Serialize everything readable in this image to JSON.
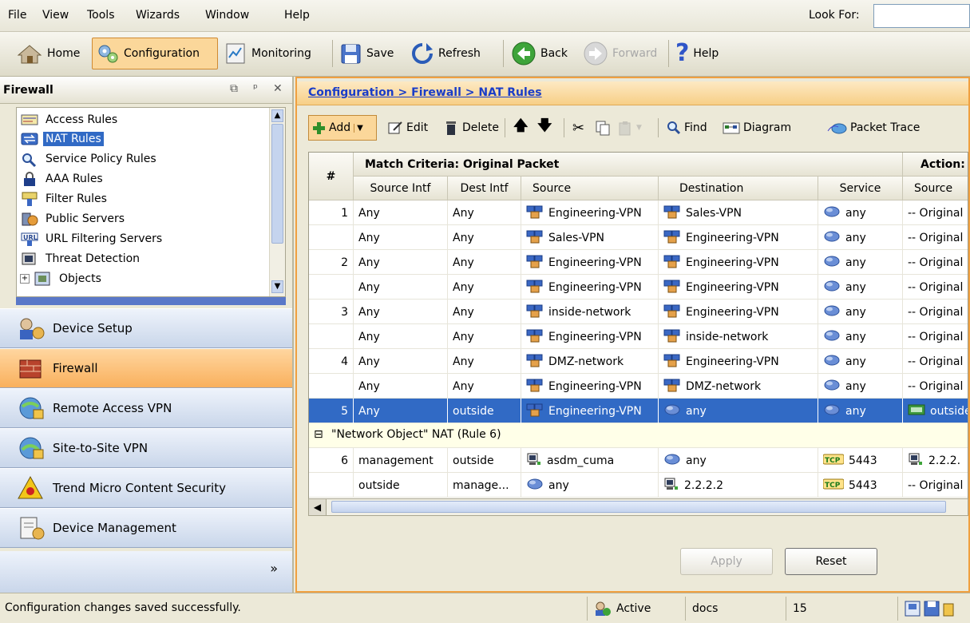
{
  "menubar": {
    "items": [
      "File",
      "View",
      "Tools",
      "Wizards",
      "Window",
      "Help"
    ],
    "look_for_label": "Look For:",
    "look_for_value": ""
  },
  "toolbar": {
    "home": "Home",
    "configuration": "Configuration",
    "monitoring": "Monitoring",
    "save": "Save",
    "refresh": "Refresh",
    "back": "Back",
    "forward": "Forward",
    "help": "Help"
  },
  "left_panel": {
    "title": "Firewall",
    "tree": [
      {
        "label": "Access Rules",
        "icon": "access-rules-icon"
      },
      {
        "label": "NAT Rules",
        "icon": "nat-rules-icon",
        "selected": true
      },
      {
        "label": "Service Policy Rules",
        "icon": "magnifier-icon"
      },
      {
        "label": "AAA Rules",
        "icon": "lock-icon"
      },
      {
        "label": "Filter Rules",
        "icon": "filter-icon"
      },
      {
        "label": "Public Servers",
        "icon": "public-servers-icon"
      },
      {
        "label": "URL Filtering Servers",
        "icon": "url-icon"
      },
      {
        "label": "Threat Detection",
        "icon": "threat-icon"
      },
      {
        "label": "Objects",
        "icon": "objects-icon"
      }
    ],
    "nav": [
      {
        "label": "Device Setup",
        "icon": "device-setup-icon"
      },
      {
        "label": "Firewall",
        "icon": "firewall-icon",
        "active": true
      },
      {
        "label": "Remote Access VPN",
        "icon": "remote-vpn-icon"
      },
      {
        "label": "Site-to-Site VPN",
        "icon": "site-vpn-icon"
      },
      {
        "label": "Trend Micro Content Security",
        "icon": "biohazard-icon"
      },
      {
        "label": "Device Management",
        "icon": "device-management-icon"
      }
    ],
    "more": "»"
  },
  "main": {
    "breadcrumb": "Configuration > Firewall > NAT Rules",
    "rule_toolbar": {
      "add": "Add",
      "edit": "Edit",
      "delete": "Delete",
      "find": "Find",
      "diagram": "Diagram",
      "packet_trace": "Packet Trace"
    },
    "table": {
      "header_num": "#",
      "group_match": "Match Criteria: Original Packet",
      "group_action": "Action:",
      "columns": [
        "Source Intf",
        "Dest Intf",
        "Source",
        "Destination",
        "Service",
        "Source"
      ],
      "rows": [
        {
          "num": "1",
          "src_intf": "Any",
          "dst_intf": "Any",
          "source": "Engineering-VPN",
          "source_icon": "network-group-icon",
          "destination": "Sales-VPN",
          "destination_icon": "network-group-icon",
          "service": "any",
          "service_icon": "service-any-icon",
          "action_source": "-- Original"
        },
        {
          "num": "",
          "src_intf": "Any",
          "dst_intf": "Any",
          "source": "Sales-VPN",
          "source_icon": "network-group-icon",
          "destination": "Engineering-VPN",
          "destination_icon": "network-group-icon",
          "service": "any",
          "service_icon": "service-any-icon",
          "action_source": "-- Original"
        },
        {
          "num": "2",
          "src_intf": "Any",
          "dst_intf": "Any",
          "source": "Engineering-VPN",
          "source_icon": "network-group-icon",
          "destination": "Engineering-VPN",
          "destination_icon": "network-group-icon",
          "service": "any",
          "service_icon": "service-any-icon",
          "action_source": "-- Original"
        },
        {
          "num": "",
          "src_intf": "Any",
          "dst_intf": "Any",
          "source": "Engineering-VPN",
          "source_icon": "network-group-icon",
          "destination": "Engineering-VPN",
          "destination_icon": "network-group-icon",
          "service": "any",
          "service_icon": "service-any-icon",
          "action_source": "-- Original"
        },
        {
          "num": "3",
          "src_intf": "Any",
          "dst_intf": "Any",
          "source": "inside-network",
          "source_icon": "network-group-icon",
          "destination": "Engineering-VPN",
          "destination_icon": "network-group-icon",
          "service": "any",
          "service_icon": "service-any-icon",
          "action_source": "-- Original"
        },
        {
          "num": "",
          "src_intf": "Any",
          "dst_intf": "Any",
          "source": "Engineering-VPN",
          "source_icon": "network-group-icon",
          "destination": "inside-network",
          "destination_icon": "network-group-icon",
          "service": "any",
          "service_icon": "service-any-icon",
          "action_source": "-- Original"
        },
        {
          "num": "4",
          "src_intf": "Any",
          "dst_intf": "Any",
          "source": "DMZ-network",
          "source_icon": "network-group-icon",
          "destination": "Engineering-VPN",
          "destination_icon": "network-group-icon",
          "service": "any",
          "service_icon": "service-any-icon",
          "action_source": "-- Original"
        },
        {
          "num": "",
          "src_intf": "Any",
          "dst_intf": "Any",
          "source": "Engineering-VPN",
          "source_icon": "network-group-icon",
          "destination": "DMZ-network",
          "destination_icon": "network-group-icon",
          "service": "any",
          "service_icon": "service-any-icon",
          "action_source": "-- Original"
        },
        {
          "num": "5",
          "src_intf": "Any",
          "dst_intf": "outside",
          "source": "Engineering-VPN",
          "source_icon": "network-group-icon",
          "destination": "any",
          "destination_icon": "network-any-icon",
          "service": "any",
          "service_icon": "service-any-icon",
          "action_source": "outside",
          "action_icon": "interface-icon",
          "selected": true
        }
      ],
      "group_row": {
        "label": "\"Network Object\" NAT (Rule 6)",
        "toggle": "⊟"
      },
      "rows2": [
        {
          "num": "6",
          "src_intf": "management",
          "dst_intf": "outside",
          "source": "asdm_cuma",
          "source_icon": "host-icon",
          "destination": "any",
          "destination_icon": "network-any-icon",
          "service": "5443",
          "service_icon": "tcp-icon",
          "action_source": "2.2.2.",
          "action_icon": "host-icon"
        },
        {
          "num": "",
          "src_intf": "outside",
          "dst_intf": "manage...",
          "source": "any",
          "source_icon": "network-any-icon",
          "destination": "2.2.2.2",
          "destination_icon": "host-icon",
          "service": "5443",
          "service_icon": "tcp-icon",
          "action_source": "-- Original"
        }
      ]
    },
    "apply": "Apply",
    "reset": "Reset"
  },
  "statusbar": {
    "message": "Configuration changes saved successfully.",
    "status": "Active",
    "user": "docs",
    "privilege": "15"
  }
}
